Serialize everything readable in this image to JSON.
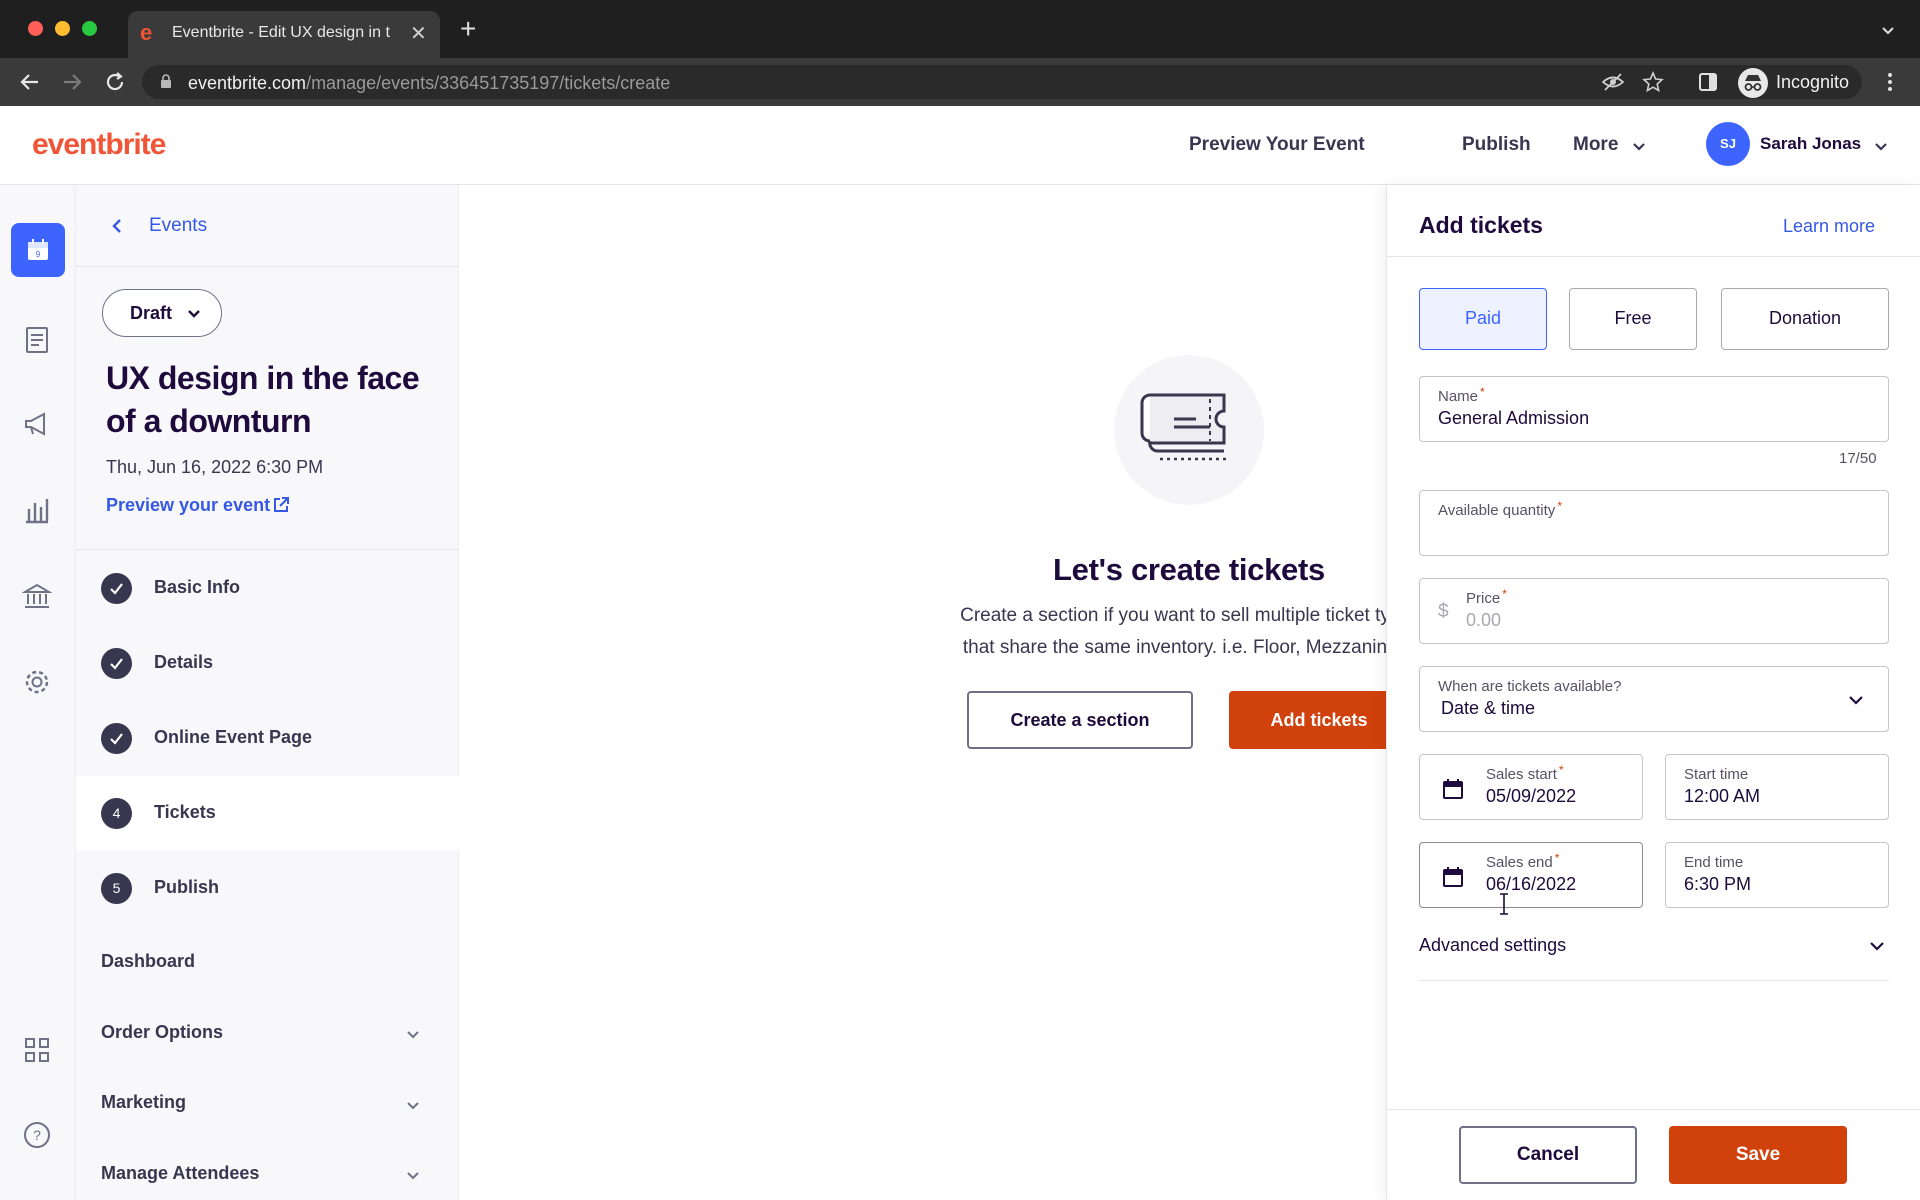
{
  "browser": {
    "tab_title": "Eventbrite - Edit UX design in t",
    "tab_favicon": "e",
    "url_host": "eventbrite.com",
    "url_path": "/manage/events/336451735197/tickets/create",
    "incognito_label": "Incognito"
  },
  "header": {
    "logo": "eventbrite",
    "preview_event": "Preview Your Event",
    "publish": "Publish",
    "more": "More",
    "avatar_initials": "SJ",
    "user_name": "Sarah Jonas"
  },
  "sidenav": {
    "back_label": "Events",
    "status": "Draft",
    "event_title": "UX design in the face of a downturn",
    "event_date": "Thu, Jun 16, 2022 6:30 PM",
    "preview_link": "Preview your event",
    "steps": [
      {
        "label": "Basic Info",
        "state": "done",
        "badge": ""
      },
      {
        "label": "Details",
        "state": "done",
        "badge": ""
      },
      {
        "label": "Online Event Page",
        "state": "done",
        "badge": ""
      },
      {
        "label": "Tickets",
        "state": "current",
        "badge": "4"
      },
      {
        "label": "Publish",
        "state": "todo",
        "badge": "5"
      }
    ],
    "sections": [
      {
        "label": "Dashboard"
      },
      {
        "label": "Order Options"
      },
      {
        "label": "Marketing"
      },
      {
        "label": "Manage Attendees"
      }
    ]
  },
  "main": {
    "empty_title": "Let's create tickets",
    "empty_desc_line1": "Create a section if you want to sell multiple ticket ty",
    "empty_desc_line2": "that share the same inventory. i.e. Floor, Mezzanin",
    "create_section": "Create a section",
    "add_tickets": "Add tickets"
  },
  "drawer": {
    "title": "Add tickets",
    "learn_more": "Learn more",
    "ticket_types": [
      {
        "label": "Paid",
        "selected": true
      },
      {
        "label": "Free",
        "selected": false
      },
      {
        "label": "Donation",
        "selected": false
      }
    ],
    "name_label": "Name",
    "name_value": "General Admission",
    "name_counter": "17/50",
    "quantity_label": "Available quantity",
    "quantity_value": "",
    "price_label": "Price",
    "price_currency": "$",
    "price_placeholder": "0.00",
    "availability_label": "When are tickets available?",
    "availability_value": "Date & time",
    "sales_start_label": "Sales start",
    "sales_start_value": "05/09/2022",
    "start_time_label": "Start time",
    "start_time_value": "12:00 AM",
    "sales_end_label": "Sales end",
    "sales_end_value": "06/16/2022",
    "end_time_label": "End time",
    "end_time_value": "6:30 PM",
    "advanced_settings": "Advanced settings",
    "cancel": "Cancel",
    "save": "Save"
  },
  "colors": {
    "brand": "#f05537",
    "primary_action": "#d1410c",
    "link": "#3659e3",
    "selected_accent": "#3d64ff"
  }
}
